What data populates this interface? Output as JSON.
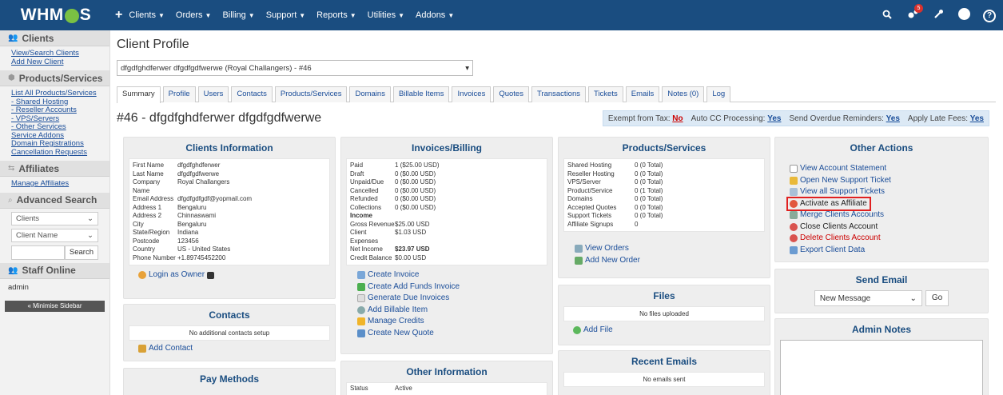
{
  "topnav": {
    "brand": "WHMCS",
    "plus": "+",
    "menu": [
      {
        "label": "Clients"
      },
      {
        "label": "Orders"
      },
      {
        "label": "Billing"
      },
      {
        "label": "Support"
      },
      {
        "label": "Reports"
      },
      {
        "label": "Utilities"
      },
      {
        "label": "Addons"
      }
    ],
    "notification_count": "5",
    "help": "?"
  },
  "sidebar": {
    "clients_heading": "Clients",
    "clients_links": [
      "View/Search Clients",
      "Add New Client"
    ],
    "products_heading": "Products/Services",
    "products_links": [
      "List All Products/Services",
      "- Shared Hosting",
      "- Reseller Accounts",
      "- VPS/Servers",
      "- Other Services",
      "Service Addons",
      "Domain Registrations",
      "Cancellation Requests"
    ],
    "affiliates_heading": "Affiliates",
    "affiliates_links": [
      "Manage Affiliates"
    ],
    "search_heading": "Advanced Search",
    "search_type": "Clients",
    "search_field": "Client Name",
    "search_button": "Search",
    "staff_heading": "Staff Online",
    "staff_name": "admin",
    "minimise": "« Minimise Sidebar"
  },
  "main": {
    "page_title": "Client Profile",
    "client_selector": "dfgdfghdferwer dfgdfgdfwerwe (Royal Challangers) - #46",
    "tabs": [
      "Summary",
      "Profile",
      "Users",
      "Contacts",
      "Products/Services",
      "Domains",
      "Billable Items",
      "Invoices",
      "Quotes",
      "Transactions",
      "Tickets",
      "Emails",
      "Notes (0)",
      "Log"
    ],
    "client_heading": "#46 - dfgdfghdferwer dfgdfgdfwerwe",
    "tax_bar": {
      "exempt_label": "Exempt from Tax:",
      "exempt_value": "No",
      "autocc_label": "Auto CC Processing:",
      "autocc_value": "Yes",
      "overdue_label": "Send Overdue Reminders:",
      "overdue_value": "Yes",
      "latefees_label": "Apply Late Fees:",
      "latefees_value": "Yes"
    }
  },
  "client_info": {
    "title": "Clients Information",
    "rows": [
      {
        "k": "First Name",
        "v": "dfgdfghdferwer"
      },
      {
        "k": "Last Name",
        "v": "dfgdfgdfwerwe"
      },
      {
        "k": "Company Name",
        "v": "Royal Challangers"
      },
      {
        "k": "Email Address",
        "v": "dfgdfgdfgdf@yopmail.com"
      },
      {
        "k": "Address 1",
        "v": "Bengaluru"
      },
      {
        "k": "Address 2",
        "v": "Chinnaswami"
      },
      {
        "k": "City",
        "v": "Bengaluru"
      },
      {
        "k": "State/Region",
        "v": "Indiana"
      },
      {
        "k": "Postcode",
        "v": "123456"
      },
      {
        "k": "Country",
        "v": "US - United States"
      },
      {
        "k": "Phone Number",
        "v": "+1.89745452200"
      }
    ],
    "login_owner": "Login as Owner"
  },
  "contacts": {
    "title": "Contacts",
    "empty": "No additional contacts setup",
    "add": "Add Contact"
  },
  "pay_methods": {
    "title": "Pay Methods"
  },
  "invoices": {
    "title": "Invoices/Billing",
    "rows": [
      {
        "k": "Paid",
        "v": "1 ($25.00 USD)"
      },
      {
        "k": "Draft",
        "v": "0 ($0.00 USD)"
      },
      {
        "k": "Unpaid/Due",
        "v": "0 ($0.00 USD)"
      },
      {
        "k": "Cancelled",
        "v": "0 ($0.00 USD)"
      },
      {
        "k": "Refunded",
        "v": "0 ($0.00 USD)"
      },
      {
        "k": "Collections",
        "v": "0 ($0.00 USD)"
      },
      {
        "k": "Income",
        "v": ""
      },
      {
        "k": "Gross Revenue",
        "v": "$25.00 USD"
      },
      {
        "k": "Client Expenses",
        "v": "$1.03 USD"
      },
      {
        "k": "Net Income",
        "v": "$23.97 USD"
      },
      {
        "k": "Credit Balance",
        "v": "$0.00 USD"
      }
    ],
    "actions": [
      "Create Invoice",
      "Create Add Funds Invoice",
      "Generate Due Invoices",
      "Add Billable Item",
      "Manage Credits",
      "Create New Quote"
    ]
  },
  "other_info": {
    "title": "Other Information",
    "rows": [
      {
        "k": "Status",
        "v": "Active"
      }
    ]
  },
  "products": {
    "title": "Products/Services",
    "rows": [
      {
        "k": "Shared Hosting",
        "v": "0 (0 Total)"
      },
      {
        "k": "Reseller Hosting",
        "v": "0 (0 Total)"
      },
      {
        "k": "VPS/Server",
        "v": "0 (0 Total)"
      },
      {
        "k": "Product/Service",
        "v": "0 (1 Total)"
      },
      {
        "k": "Domains",
        "v": "0 (0 Total)"
      },
      {
        "k": "Accepted Quotes",
        "v": "0 (0 Total)"
      },
      {
        "k": "Support Tickets",
        "v": "0 (0 Total)"
      },
      {
        "k": "Affiliate Signups",
        "v": "0"
      }
    ],
    "actions": [
      "View Orders",
      "Add New Order"
    ]
  },
  "files": {
    "title": "Files",
    "empty": "No files uploaded",
    "add": "Add File"
  },
  "recent_emails": {
    "title": "Recent Emails",
    "empty": "No emails sent"
  },
  "other_actions": {
    "title": "Other Actions",
    "links": [
      "View Account Statement",
      "Open New Support Ticket",
      "View all Support Tickets",
      "Activate as Affiliate",
      "Merge Clients Accounts",
      "Close Clients Account",
      "Delete Clients Account",
      "Export Client Data"
    ]
  },
  "send_email": {
    "title": "Send Email",
    "selected": "New Message",
    "go": "Go"
  },
  "admin_notes": {
    "title": "Admin Notes"
  }
}
